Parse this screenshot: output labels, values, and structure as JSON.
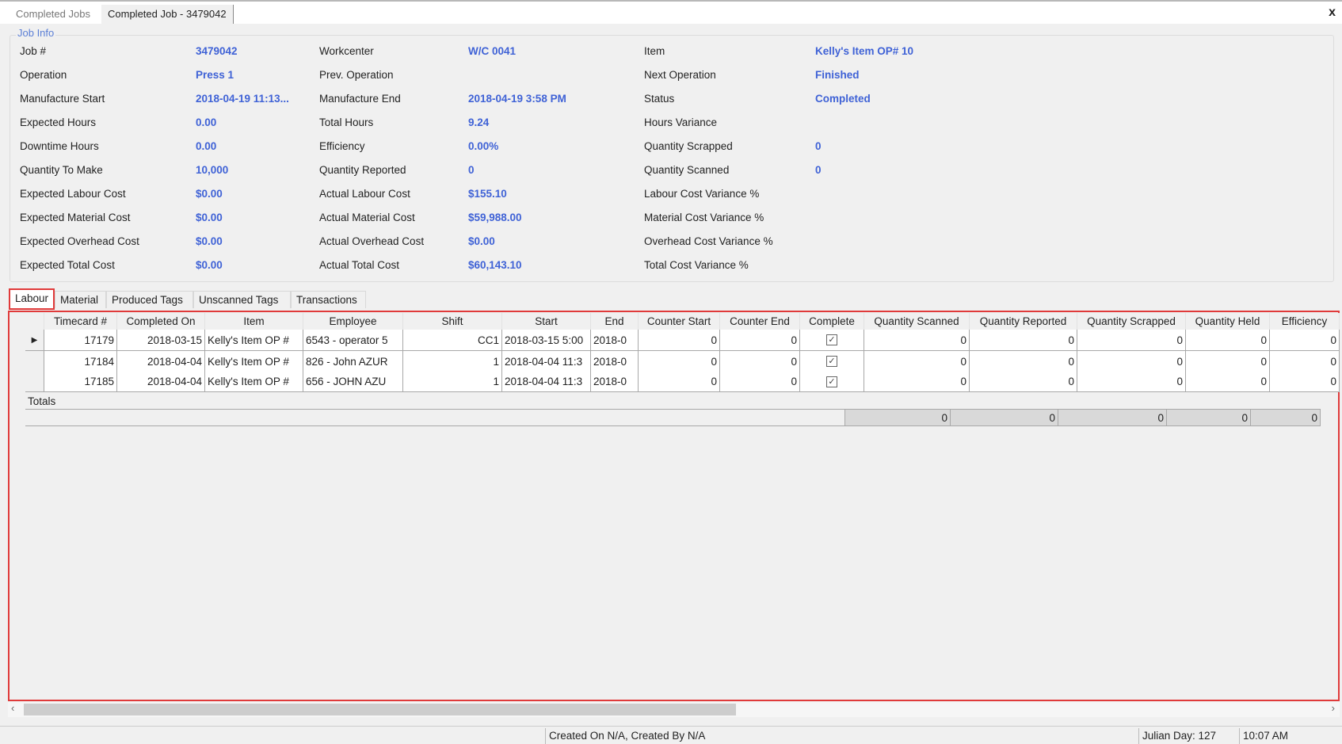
{
  "doc_tabs": [
    "Completed Jobs",
    "Completed Job - 3479042"
  ],
  "close_label": "x",
  "job_info": {
    "title": "Job Info",
    "columns": [
      [
        [
          "Job #",
          "3479042"
        ],
        [
          "Operation",
          "Press 1"
        ],
        [
          "Manufacture Start",
          "2018-04-19 11:13..."
        ],
        [
          "Expected Hours",
          "0.00"
        ],
        [
          "Downtime Hours",
          "0.00"
        ],
        [
          "Quantity To Make",
          "10,000"
        ],
        [
          "Expected Labour Cost",
          "$0.00"
        ],
        [
          "Expected Material Cost",
          "$0.00"
        ],
        [
          "Expected Overhead Cost",
          "$0.00"
        ],
        [
          "Expected Total Cost",
          "$0.00"
        ]
      ],
      [
        [
          "Workcenter",
          "W/C 0041"
        ],
        [
          "Prev. Operation",
          ""
        ],
        [
          "Manufacture End",
          "2018-04-19 3:58 PM"
        ],
        [
          "Total Hours",
          "9.24"
        ],
        [
          "Efficiency",
          "0.00%"
        ],
        [
          "Quantity Reported",
          "0"
        ],
        [
          "Actual Labour Cost",
          "$155.10"
        ],
        [
          "Actual Material Cost",
          "$59,988.00"
        ],
        [
          "Actual Overhead Cost",
          "$0.00"
        ],
        [
          "Actual Total Cost",
          "$60,143.10"
        ]
      ],
      [
        [
          "Item",
          "Kelly's Item OP# 10"
        ],
        [
          "Next Operation",
          "Finished"
        ],
        [
          "Status",
          "Completed"
        ],
        [
          "Hours Variance",
          ""
        ],
        [
          "Quantity Scrapped",
          "0"
        ],
        [
          "Quantity Scanned",
          "0"
        ],
        [
          "Labour Cost Variance %",
          ""
        ],
        [
          "Material Cost Variance %",
          ""
        ],
        [
          "Overhead Cost Variance %",
          ""
        ],
        [
          "Total Cost Variance %",
          ""
        ]
      ]
    ]
  },
  "sub_tabs": [
    "Labour",
    "Material",
    "Produced Tags",
    "Unscanned Tags",
    "Transactions"
  ],
  "active_sub_tab": "Labour",
  "grid": {
    "columns": [
      "Timecard #",
      "Completed On",
      "Item",
      "Employee",
      "Shift",
      "Start",
      "End",
      "Counter Start",
      "Counter End",
      "Complete",
      "Quantity Scanned",
      "Quantity Reported",
      "Quantity Scrapped",
      "Quantity Held",
      "Efficiency"
    ],
    "rows": [
      [
        "17179",
        "2018-03-15",
        "Kelly's Item OP #",
        "6543 - operator 5",
        "CC1",
        "2018-03-15 5:00",
        "2018-0",
        "0",
        "0",
        true,
        "0",
        "0",
        "0",
        "0",
        "0"
      ],
      [
        "17184",
        "2018-04-04",
        "Kelly's Item OP #",
        "826 - John AZUR",
        "1",
        "2018-04-04 11:3",
        "2018-0",
        "0",
        "0",
        true,
        "0",
        "0",
        "0",
        "0",
        "0"
      ],
      [
        "17185",
        "2018-04-04",
        "Kelly's Item OP #",
        "656 - JOHN AZU",
        "1",
        "2018-04-04 11:3",
        "2018-0",
        "0",
        "0",
        true,
        "0",
        "0",
        "0",
        "0",
        "0"
      ]
    ],
    "totals_label": "Totals",
    "totals": [
      "0",
      "0",
      "0",
      "0",
      "0"
    ]
  },
  "status_bar": {
    "created": "Created On N/A, Created By N/A",
    "julian_day": "Julian Day: 127",
    "time": "10:07 AM"
  },
  "colors": {
    "value": "#3f62d6",
    "highlight": "#e03a3a"
  }
}
